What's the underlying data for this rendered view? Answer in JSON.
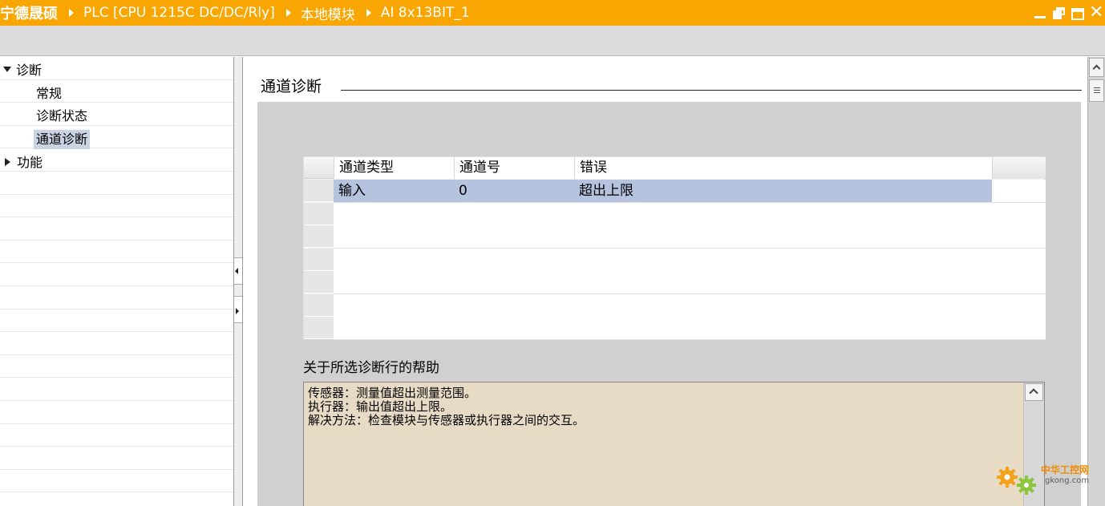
{
  "titlebar": {
    "crumbs": [
      "宁德晟硕",
      "PLC [CPU 1215C DC/DC/Rly]",
      "本地模块",
      "AI 8x13BIT_1"
    ],
    "accent_color": "#f9a602",
    "controls": [
      "minimize-icon",
      "float-icon",
      "maximize-icon",
      "close-icon"
    ],
    "close_glyph": "✕"
  },
  "tree": {
    "items": [
      {
        "label": "诊断",
        "expanded": true
      },
      {
        "label": "常规"
      },
      {
        "label": "诊断状态"
      },
      {
        "label": "通道诊断",
        "selected": true
      },
      {
        "label": "功能",
        "expanded": false
      }
    ]
  },
  "main": {
    "section_title": "通道诊断",
    "table": {
      "columns": [
        "通道类型",
        "通道号",
        "错误"
      ],
      "rows": [
        {
          "type": "输入",
          "number": "0",
          "error": "超出上限"
        }
      ],
      "selected_row_color": "#b5c3de"
    },
    "help": {
      "label": "关于所选诊断行的帮助",
      "lines": [
        "传感器：测量值超出测量范围。",
        "执行器：输出值超出上限。",
        "解决方法：检查模块与传感器或执行器之间的交互。"
      ],
      "background": "#e8dbc5"
    }
  },
  "watermark": {
    "line1": "中华工控网",
    "line2": "gkong.com"
  }
}
